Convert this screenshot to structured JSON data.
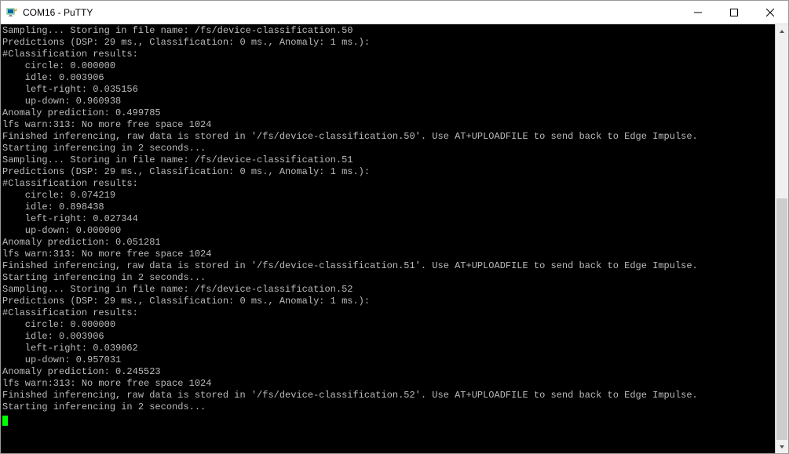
{
  "window": {
    "title": "COM16 - PuTTY"
  },
  "terminal": {
    "lines": [
      "Sampling... Storing in file name: /fs/device-classification.50",
      "Predictions (DSP: 29 ms., Classification: 0 ms., Anomaly: 1 ms.):",
      "#Classification results:",
      "    circle: 0.000000",
      "    idle: 0.003906",
      "    left-right: 0.035156",
      "    up-down: 0.960938",
      "Anomaly prediction: 0.499785",
      "lfs warn:313: No more free space 1024",
      "Finished inferencing, raw data is stored in '/fs/device-classification.50'. Use AT+UPLOADFILE to send back to Edge Impulse.",
      "Starting inferencing in 2 seconds...",
      "Sampling... Storing in file name: /fs/device-classification.51",
      "Predictions (DSP: 29 ms., Classification: 0 ms., Anomaly: 1 ms.):",
      "#Classification results:",
      "    circle: 0.074219",
      "    idle: 0.898438",
      "    left-right: 0.027344",
      "    up-down: 0.000000",
      "Anomaly prediction: 0.051281",
      "lfs warn:313: No more free space 1024",
      "Finished inferencing, raw data is stored in '/fs/device-classification.51'. Use AT+UPLOADFILE to send back to Edge Impulse.",
      "Starting inferencing in 2 seconds...",
      "Sampling... Storing in file name: /fs/device-classification.52",
      "Predictions (DSP: 29 ms., Classification: 0 ms., Anomaly: 1 ms.):",
      "#Classification results:",
      "    circle: 0.000000",
      "    idle: 0.003906",
      "    left-right: 0.039062",
      "    up-down: 0.957031",
      "Anomaly prediction: 0.245523",
      "lfs warn:313: No more free space 1024",
      "Finished inferencing, raw data is stored in '/fs/device-classification.52'. Use AT+UPLOADFILE to send back to Edge Impulse.",
      "Starting inferencing in 2 seconds..."
    ]
  }
}
